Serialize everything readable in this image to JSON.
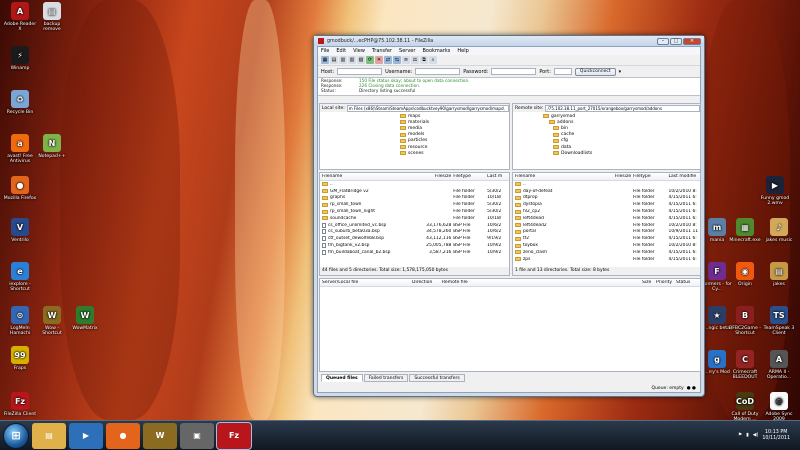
{
  "desktop": {
    "left_icons": [
      {
        "label": "Adobe Reader X",
        "color": "#b01818",
        "glyph": "A"
      },
      {
        "label": "backup remove",
        "color": "#d9dde3",
        "glyph": "▤"
      },
      {
        "label": "Winamp",
        "color": "#1b1b1b",
        "glyph": "⚡"
      },
      {
        "label": "Recycle Bin",
        "color": "#7aa6d6",
        "glyph": "♻"
      },
      {
        "label": "avast! Free Antivirus",
        "color": "#f06a10",
        "glyph": "a"
      },
      {
        "label": "Notepad++",
        "color": "#7fb24a",
        "glyph": "N"
      },
      {
        "label": "Mozilla Firefox",
        "color": "#e2651b",
        "glyph": "●"
      },
      {
        "label": "Ventrilo",
        "color": "#284a8c",
        "glyph": "V"
      },
      {
        "label": "iexplore - Shortcut",
        "color": "#2a7fd6",
        "glyph": "e"
      },
      {
        "label": "LogMeIn Hamachi",
        "color": "#3367b3",
        "glyph": "⊙"
      },
      {
        "label": "Wow - Shortcut",
        "color": "#8a6b21",
        "glyph": "W"
      },
      {
        "label": "WowMatrix",
        "color": "#2d7d2d",
        "glyph": "W"
      },
      {
        "label": "Fraps",
        "color": "#d4b000",
        "glyph": "99"
      },
      {
        "label": "FileZilla Client",
        "color": "#b8161b",
        "glyph": "Fz"
      }
    ],
    "right_icons": [
      {
        "label": "Funny gmod 2.wmv",
        "color": "#1c2338",
        "glyph": "▶"
      },
      {
        "label": "mania",
        "color": "#5b7fa5",
        "glyph": "m"
      },
      {
        "label": "Minecraft.exe",
        "color": "#4f8a30",
        "glyph": "▦"
      },
      {
        "label": "jakes music",
        "color": "#d2a95a",
        "glyph": "♪"
      },
      {
        "label": "Formers - for Cy...",
        "color": "#6f2d90",
        "glyph": "F"
      },
      {
        "label": "Origin",
        "color": "#f05a10",
        "glyph": "◉"
      },
      {
        "label": "jakes",
        "color": "#c69b45",
        "glyph": "▤"
      },
      {
        "label": "...ngic beta",
        "color": "#2c3e66",
        "glyph": "★"
      },
      {
        "label": "BFBC2Game - Shortcut",
        "color": "#8a1f1f",
        "glyph": "B"
      },
      {
        "label": "TeamSpeak 3 Client",
        "color": "#2a4f8c",
        "glyph": "TS"
      },
      {
        "label": "...rry's Mod",
        "color": "#2872c8",
        "glyph": "g"
      },
      {
        "label": "Crimecraft BLEEDOUT",
        "color": "#942323",
        "glyph": "C"
      },
      {
        "label": "ARMA II - Operatio...",
        "color": "#555",
        "glyph": "A"
      },
      {
        "label": "Call of Duty Modern ...",
        "color": "#4a3a12",
        "glyph": "CoD"
      },
      {
        "label": "Adobe Sync 2009",
        "color": "#fafafa",
        "glyph": "@"
      }
    ]
  },
  "window": {
    "title": "gmodbuck/...ecPHP@75.102.38.11 - FileZilla",
    "menu": [
      "File",
      "Edit",
      "View",
      "Transfer",
      "Server",
      "Bookmarks",
      "Help"
    ],
    "quickconnect": {
      "host_label": "Host:",
      "user_label": "Username:",
      "pass_label": "Password:",
      "port_label": "Port:",
      "button": "Quickconnect"
    },
    "log": [
      {
        "k": "Response:",
        "v": "150 File status okay; about to open data connection.",
        "color": "#2a8a2a"
      },
      {
        "k": "Response:",
        "v": "226 Closing data connection.",
        "color": "#2a8a2a"
      },
      {
        "k": "Status:",
        "v": "Directory listing successful",
        "color": "#222"
      }
    ],
    "local": {
      "site_label": "Local site:",
      "path": "m Files (x86)\\Steam\\SteamApps\\codbucktvey90\\garrysmod\\garrysmod\\maps\\",
      "tree": [
        "maps",
        "materials",
        "media",
        "models",
        "particles",
        "resource",
        "scenes"
      ],
      "columns": [
        "Filename",
        "Filesize",
        "Filetype",
        "Last m"
      ],
      "files": [
        {
          "name": "..",
          "size": "",
          "type": "",
          "date": "",
          "kind": "folder"
        },
        {
          "name": "GM_FlatBridge v2",
          "size": "",
          "type": "File folder",
          "date": "5/30/2",
          "kind": "folder"
        },
        {
          "name": "graphs",
          "size": "",
          "type": "File folder",
          "date": "10/18/",
          "kind": "folder"
        },
        {
          "name": "rp_small_town",
          "size": "",
          "type": "File folder",
          "date": "5/30/2",
          "kind": "folder"
        },
        {
          "name": "rp_small_town_night",
          "size": "",
          "type": "File folder",
          "date": "5/30/2",
          "kind": "folder"
        },
        {
          "name": "soundcache",
          "size": "",
          "type": "File folder",
          "date": "10/18/",
          "kind": "folder"
        },
        {
          "name": "cs_office_unlimited_vc.bsp",
          "size": "33,176,628",
          "type": "BSP File",
          "date": "10/6/2",
          "kind": "file"
        },
        {
          "name": "cs_suburb_beta03a.bsp",
          "size": "34,578,260",
          "type": "BSP File",
          "date": "10/6/2",
          "kind": "file"
        },
        {
          "name": "ctf_outset_dewolfeb8.bsp",
          "size": "43,112,116",
          "type": "BSP File",
          "date": "9/19/2",
          "kind": "file"
        },
        {
          "name": "fm_bigtank_v2.bsp",
          "size": "25,005,788",
          "type": "BSP File",
          "date": "10/9/2",
          "kind": "file"
        },
        {
          "name": "fm_buildaboat_canal_b2.bsp",
          "size": "3,587,216",
          "type": "BSP File",
          "date": "10/9/2",
          "kind": "file"
        }
      ],
      "status": "44 files and 5 directories. Total size: 1,578,175,050 bytes"
    },
    "remote": {
      "site_label": "Remote site:",
      "path": "/75.102.38.11_port_27015/orangebox/garrysmod/addons",
      "tree": [
        "garrysmod",
        "addons",
        "bin",
        "cache",
        "cfg",
        "data",
        "Downloadlists"
      ],
      "columns": [
        "Filename",
        "Filesize",
        "Filetype",
        "Last modifie"
      ],
      "files": [
        {
          "name": "..",
          "size": "",
          "type": "",
          "date": "",
          "kind": "folder"
        },
        {
          "name": "day-of-defeat",
          "size": "",
          "type": "File folder",
          "date": "10/2/2010 8:",
          "kind": "folder"
        },
        {
          "name": "dtprop",
          "size": "",
          "type": "File folder",
          "date": "4/15/2011 6:",
          "kind": "folder"
        },
        {
          "name": "dystopia",
          "size": "",
          "type": "File folder",
          "date": "4/15/2011 6:",
          "kind": "folder"
        },
        {
          "name": "hl2_cp2",
          "size": "",
          "type": "File folder",
          "date": "4/15/2011 6:",
          "kind": "folder"
        },
        {
          "name": "left4dead",
          "size": "",
          "type": "File folder",
          "date": "4/15/2011 6:",
          "kind": "folder"
        },
        {
          "name": "left4dead2",
          "size": "",
          "type": "File folder",
          "date": "10/2/2010 8:",
          "kind": "folder"
        },
        {
          "name": "portal",
          "size": "",
          "type": "File folder",
          "date": "10/9/2011 11",
          "kind": "folder"
        },
        {
          "name": "tf2",
          "size": "",
          "type": "File folder",
          "date": "4/15/2011 6:",
          "kind": "folder"
        },
        {
          "name": "toybox",
          "size": "",
          "type": "File folder",
          "date": "10/2/2010 8:",
          "kind": "folder"
        },
        {
          "name": "zeno_clash",
          "size": "",
          "type": "File folder",
          "date": "4/15/2011 6:",
          "kind": "folder"
        },
        {
          "name": "zps",
          "size": "",
          "type": "File folder",
          "date": "4/15/2011 6:",
          "kind": "folder"
        }
      ],
      "status": "1 file and 13 directories. Total size: 8 bytes"
    },
    "queue": {
      "columns": [
        "Server/Local file",
        "Direction",
        "Remote file",
        "Size",
        "Priority",
        "Status"
      ],
      "tabs": [
        "Queued files",
        "Failed transfers",
        "Successful transfers"
      ],
      "status": "Queue: empty"
    }
  },
  "taskbar": {
    "start_glyph": "⊞",
    "items": [
      {
        "name": "explorer",
        "color": "#e0b04a",
        "glyph": "▤"
      },
      {
        "name": "media-player",
        "color": "#2d6fb8",
        "glyph": "▶"
      },
      {
        "name": "firefox",
        "color": "#e2651b",
        "glyph": "●"
      },
      {
        "name": "wow",
        "color": "#8a6b21",
        "glyph": "W"
      },
      {
        "name": "screenshot",
        "color": "#666",
        "glyph": "▣"
      },
      {
        "name": "filezilla",
        "color": "#b8161b",
        "glyph": "Fz"
      }
    ],
    "time": "10:13 PM",
    "date": "10/11/2011"
  }
}
